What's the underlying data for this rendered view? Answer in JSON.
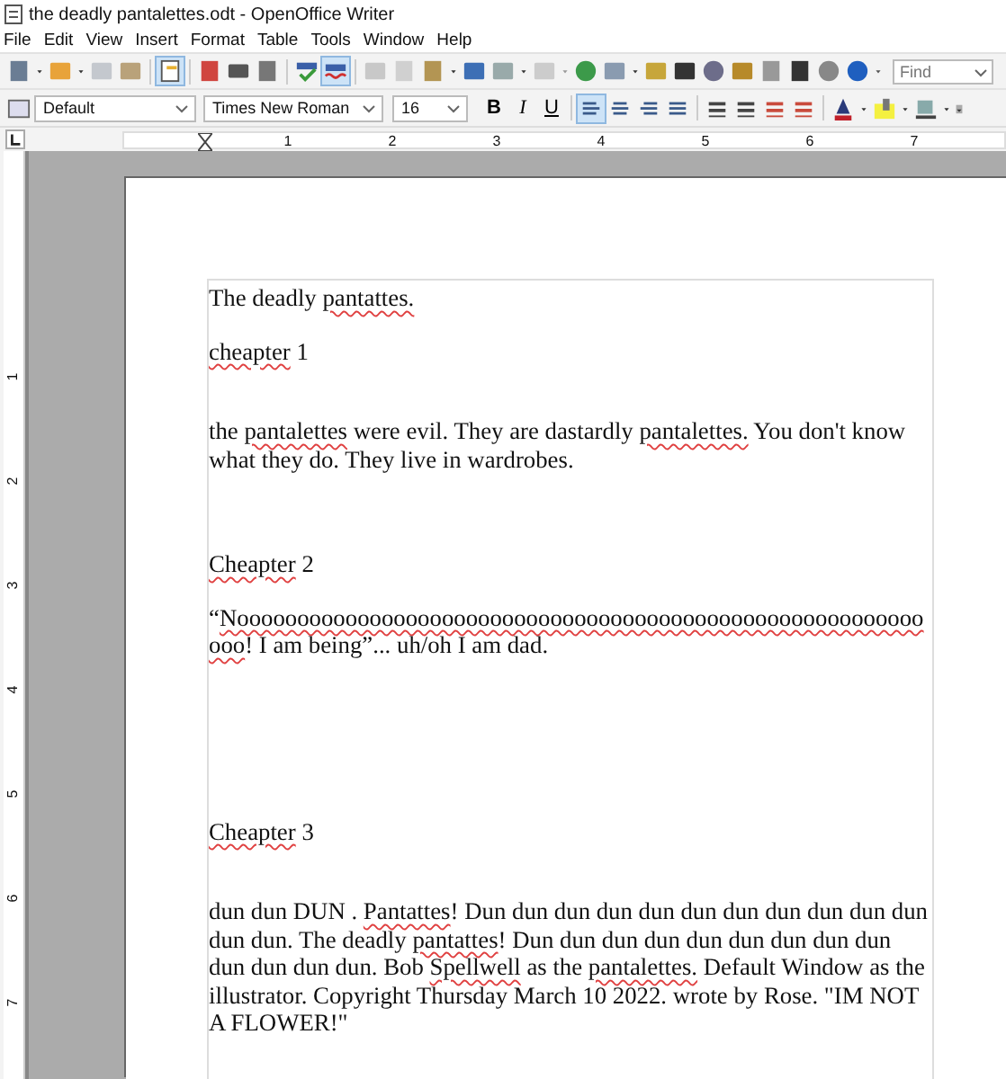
{
  "window": {
    "title": "the deadly pantalettes.odt - OpenOffice Writer"
  },
  "menu": [
    "File",
    "Edit",
    "View",
    "Insert",
    "Format",
    "Table",
    "Tools",
    "Window",
    "Help"
  ],
  "standard_toolbar": {
    "edit_mode_on": true,
    "autospellcheck_on": true,
    "find": {
      "placeholder": "Find"
    }
  },
  "formatting_toolbar": {
    "paragraph_style": "Default",
    "font_name": "Times New Roman",
    "font_size": "16",
    "format_buttons": [
      "B",
      "I",
      "U"
    ],
    "alignment_buttons": [
      {
        "kind": "left",
        "selected": true
      },
      {
        "kind": "center",
        "selected": false
      },
      {
        "kind": "right",
        "selected": false
      },
      {
        "kind": "justify",
        "selected": false
      }
    ]
  },
  "ruler": {
    "labels": [
      "1",
      "2",
      "3",
      "4",
      "5",
      "6",
      "7"
    ]
  },
  "vertical_ruler": {
    "labels": [
      "1",
      "2",
      "3",
      "4",
      "5",
      "6",
      "7"
    ]
  },
  "document": {
    "paragraphs": [
      {
        "segments": [
          {
            "text": "The deadly ",
            "misspelled": false
          },
          {
            "text": "pantattes.",
            "misspelled": true
          }
        ]
      },
      {
        "segments": [
          {
            "text": "cheapter",
            "misspelled": true
          },
          {
            "text": " 1",
            "misspelled": false
          }
        ]
      },
      {
        "segments": [
          {
            "text": "the ",
            "misspelled": false
          },
          {
            "text": "pantalettes",
            "misspelled": true
          },
          {
            "text": " were evil. They are dastardly ",
            "misspelled": false
          },
          {
            "text": "pantalettes.",
            "misspelled": true
          },
          {
            "text": " You don't know what they do. They live in wardrobes.",
            "misspelled": false
          }
        ]
      },
      {
        "segments": [
          {
            "text": "Cheapter",
            "misspelled": true
          },
          {
            "text": " 2",
            "misspelled": false
          }
        ]
      },
      {
        "segments": [
          {
            "text": "“",
            "misspelled": false
          },
          {
            "text": "Noooooooooooooooooooooooooooooooooooooooooooooooooooooooooooo",
            "misspelled": true
          },
          {
            "text": "! I am being”... uh/oh I am dad.",
            "misspelled": false
          }
        ]
      },
      {
        "segments": [
          {
            "text": "Cheapter",
            "misspelled": true
          },
          {
            "text": " 3",
            "misspelled": false
          }
        ]
      },
      {
        "segments": [
          {
            "text": "dun dun DUN . ",
            "misspelled": false
          },
          {
            "text": "Pantattes",
            "misspelled": true
          },
          {
            "text": "! Dun dun dun dun dun dun dun dun dun dun dun dun dun. The deadly ",
            "misspelled": false
          },
          {
            "text": "pantattes",
            "misspelled": true
          },
          {
            "text": "! Dun dun dun dun dun dun dun dun dun dun dun dun dun. Bob ",
            "misspelled": false
          },
          {
            "text": "Spellwell",
            "misspelled": true
          },
          {
            "text": " as the ",
            "misspelled": false
          },
          {
            "text": "pantalettes.",
            "misspelled": true
          },
          {
            "text": " Default Window as the illustrator. Copyright Thursday March 10 2022. wrote by Rose. \"IM NOT A FLOWER!\"",
            "misspelled": false
          }
        ]
      }
    ]
  }
}
